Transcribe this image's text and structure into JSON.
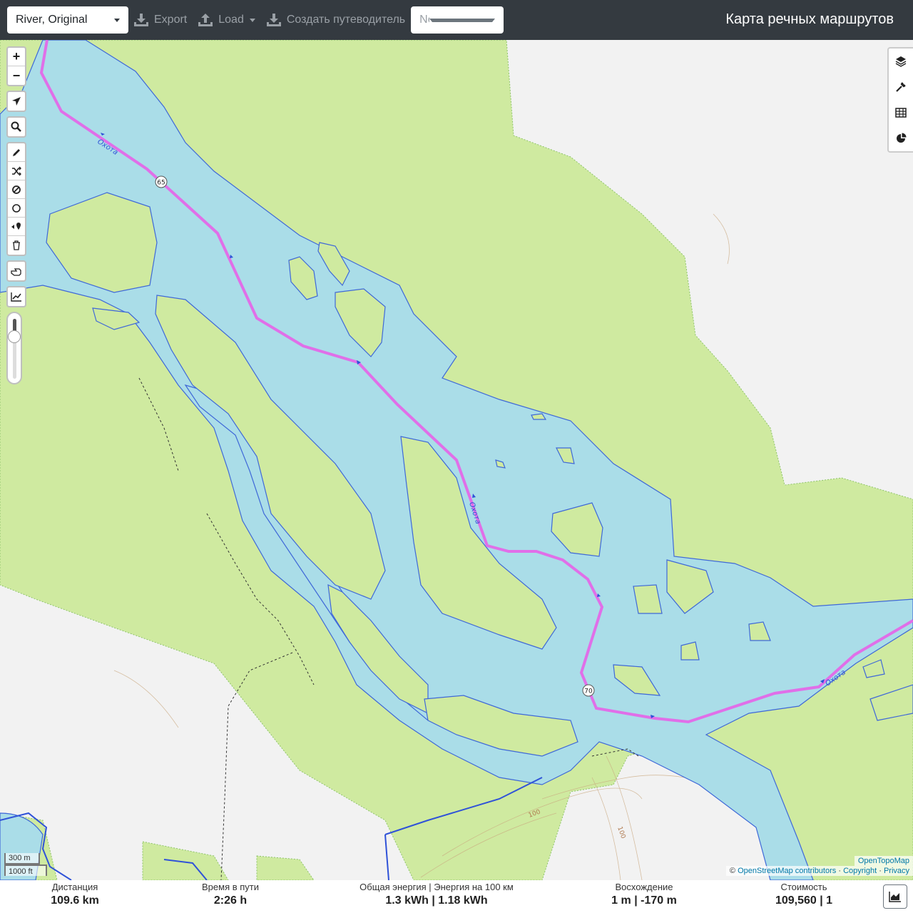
{
  "header": {
    "profile_select": "River, Original",
    "export_label": "Export",
    "load_label": "Load",
    "guide_label": "Создать путеводитель",
    "selection_placeholder": "Nothing selected",
    "app_title": "Карта речных маршрутов"
  },
  "map": {
    "river_labels": [
      "Охота",
      "Охота",
      "Охота"
    ],
    "waypoint_markers": [
      "65",
      "70"
    ],
    "contour_labels": [
      "100",
      "100"
    ],
    "colors": {
      "water": "#aadde8",
      "forest": "#cfeaa0",
      "route": "#e06fe8",
      "river_line": "#3f68d8",
      "background": "#f2f2f2"
    }
  },
  "map_controls": {
    "zoom_in": "+",
    "zoom_out": "−",
    "left_icons": [
      "locate-icon",
      "search-icon",
      "draw-icon",
      "shuffle-icon",
      "ban-icon",
      "circle-icon",
      "waypoint-icon",
      "trash-icon",
      "hand-icon",
      "elevation-icon"
    ],
    "right_icons": [
      "layers-icon",
      "wrench-icon",
      "table-icon",
      "pie-chart-icon"
    ]
  },
  "scale": {
    "metric": "300 m",
    "imperial": "1000 ft"
  },
  "attribution": {
    "tiles": "OpenTopoMap",
    "copy": "©",
    "osm": "OpenStreetMap contributors",
    "sep1": "·",
    "copyright": "Copyright",
    "sep2": "·",
    "privacy": "Privacy"
  },
  "stats": {
    "distance": {
      "label": "Дистанция",
      "value": "109.6 km"
    },
    "time": {
      "label": "Время в пути",
      "value": "2:26 h"
    },
    "energy": {
      "label": "Общая энергия | Энергия на 100 км",
      "value": "1.3 kWh | 1.18 kWh"
    },
    "ascent": {
      "label": "Восхождение",
      "value": "1 m | -170 m"
    },
    "cost": {
      "label": "Стоимость",
      "value": "109,560 | 1"
    }
  }
}
